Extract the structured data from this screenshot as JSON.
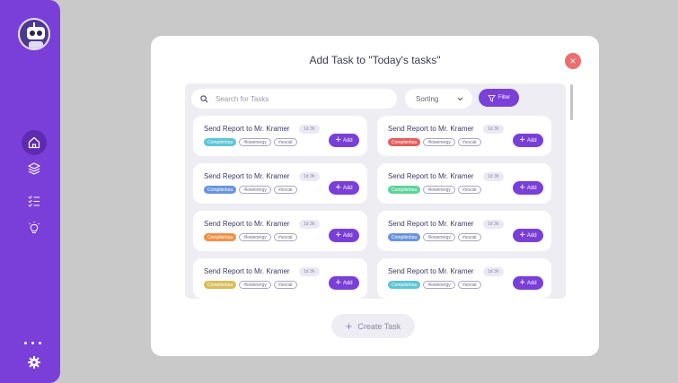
{
  "sidebar": {
    "nav": [
      {
        "icon": "home-icon",
        "active": true
      },
      {
        "icon": "layers-icon",
        "active": false
      },
      {
        "icon": "checklist-icon",
        "active": false
      },
      {
        "icon": "lightbulb-icon",
        "active": false
      }
    ],
    "bottom_icon": "gear-icon"
  },
  "modal": {
    "title": "Add Task to \"Today's tasks\"",
    "close_icon": "close-icon",
    "search": {
      "placeholder": "Search for Tasks"
    },
    "sorting": {
      "label": "Sorting"
    },
    "filter": {
      "label": "Filter"
    },
    "create_button": {
      "label": "Create Task"
    }
  },
  "colors": {
    "accent": "#7a3fd8",
    "close": "#ee6d6d"
  },
  "tasks": [
    {
      "title": "Send Report to Mr. Kramer",
      "due": "1d 3h",
      "category": "Compilerbau",
      "category_color": "#5fc4d6",
      "tags": [
        "#lowenergy",
        "#social"
      ],
      "add_label": "Add"
    },
    {
      "title": "Send Report to Mr. Kramer",
      "due": "1d 3h",
      "category": "Compilerbau",
      "category_color": "#e35f5f",
      "tags": [
        "#lowenergy",
        "#social"
      ],
      "add_label": "Add"
    },
    {
      "title": "Send Report to Mr. Kramer",
      "due": "1d 3h",
      "category": "Compilerbau",
      "category_color": "#6a95dc",
      "tags": [
        "#lowenergy",
        "#social"
      ],
      "add_label": "Add"
    },
    {
      "title": "Send Report to Mr. Kramer",
      "due": "1d 3h",
      "category": "Compilerbau",
      "category_color": "#5fd39b",
      "tags": [
        "#lowenergy",
        "#social"
      ],
      "add_label": "Add"
    },
    {
      "title": "Send Report to Mr. Kramer",
      "due": "1d 3h",
      "category": "Compilerbau",
      "category_color": "#f0914a",
      "tags": [
        "#lowenergy",
        "#social"
      ],
      "add_label": "Add"
    },
    {
      "title": "Send Report to Mr. Kramer",
      "due": "1d 3h",
      "category": "Compilerbau",
      "category_color": "#6a95dc",
      "tags": [
        "#lowenergy",
        "#social"
      ],
      "add_label": "Add"
    },
    {
      "title": "Send Report to Mr. Kramer",
      "due": "1d 3h",
      "category": "Compilerbau",
      "category_color": "#d9bd5a",
      "tags": [
        "#lowenergy",
        "#social"
      ],
      "add_label": "Add"
    },
    {
      "title": "Send Report to Mr. Kramer",
      "due": "1d 3h",
      "category": "Compilerbau",
      "category_color": "#5fc4d6",
      "tags": [
        "#lowenergy",
        "#social"
      ],
      "add_label": "Add"
    }
  ]
}
